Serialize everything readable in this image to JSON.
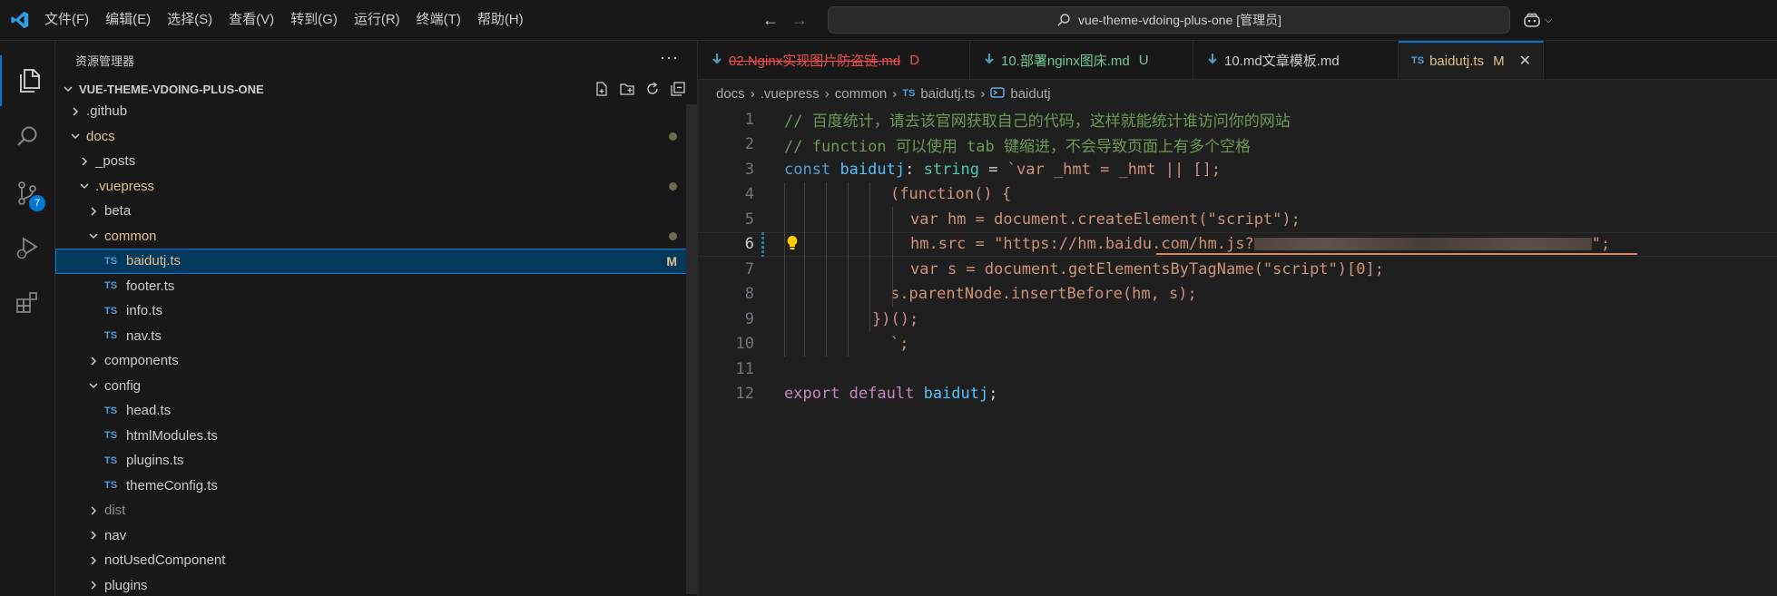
{
  "menu": [
    "文件(F)",
    "编辑(E)",
    "选择(S)",
    "查看(V)",
    "转到(G)",
    "运行(R)",
    "终端(T)",
    "帮助(H)"
  ],
  "search": {
    "text": "vue-theme-vdoing-plus-one [管理员]"
  },
  "activity": {
    "scm_badge": "7"
  },
  "sidebar": {
    "title": "资源管理器",
    "more": "···",
    "section": "VUE-THEME-VDOING-PLUS-ONE",
    "tree": [
      {
        "label": ".github",
        "type": "folder",
        "open": false,
        "level": 0
      },
      {
        "label": "docs",
        "type": "folder",
        "open": true,
        "level": 0,
        "dot": true,
        "modified": true
      },
      {
        "label": "_posts",
        "type": "folder",
        "open": false,
        "level": 1
      },
      {
        "label": ".vuepress",
        "type": "folder",
        "open": true,
        "level": 1,
        "dot": true,
        "modified": true
      },
      {
        "label": "beta",
        "type": "folder",
        "open": false,
        "level": 2
      },
      {
        "label": "common",
        "type": "folder",
        "open": true,
        "level": 2,
        "dot": true,
        "modified": true
      },
      {
        "label": "baidutj.ts",
        "type": "ts",
        "level": 3,
        "mark": "M",
        "selected": true,
        "modified": true
      },
      {
        "label": "footer.ts",
        "type": "ts",
        "level": 3
      },
      {
        "label": "info.ts",
        "type": "ts",
        "level": 3
      },
      {
        "label": "nav.ts",
        "type": "ts",
        "level": 3
      },
      {
        "label": "components",
        "type": "folder",
        "open": false,
        "level": 2
      },
      {
        "label": "config",
        "type": "folder",
        "open": true,
        "level": 2
      },
      {
        "label": "head.ts",
        "type": "ts",
        "level": 3
      },
      {
        "label": "htmlModules.ts",
        "type": "ts",
        "level": 3
      },
      {
        "label": "plugins.ts",
        "type": "ts",
        "level": 3
      },
      {
        "label": "themeConfig.ts",
        "type": "ts",
        "level": 3
      },
      {
        "label": "dist",
        "type": "folder",
        "open": false,
        "level": 2,
        "dim": true
      },
      {
        "label": "nav",
        "type": "folder",
        "open": false,
        "level": 2
      },
      {
        "label": "notUsedComponent",
        "type": "folder",
        "open": false,
        "level": 2
      },
      {
        "label": "plugins",
        "type": "folder",
        "open": false,
        "level": 2
      }
    ]
  },
  "tabs": [
    {
      "label": "02.Nginx实现图片防盗链.md",
      "status": "D",
      "color": "#f14c4c",
      "strike": true,
      "active": false
    },
    {
      "label": "10.部署nginx图床.md",
      "status": "U",
      "color": "#73c991",
      "strike": false,
      "active": false
    },
    {
      "label": "10.md文章模板.md",
      "status": "",
      "color": "#cccccc",
      "strike": false,
      "active": false
    },
    {
      "label": "baidutj.ts",
      "status": "M",
      "color": "#e2c08d",
      "strike": false,
      "active": true,
      "ts": true
    }
  ],
  "breadcrumb": [
    "docs",
    ".vuepress",
    "common",
    "baidutj.ts",
    "baidutj"
  ],
  "code": {
    "current_line": 6,
    "lines": [
      "1",
      "2",
      "3",
      "4",
      "5",
      "6",
      "7",
      "8",
      "9",
      "10",
      "11",
      "12"
    ],
    "l1": "// 百度统计，请去该官网获取自己的代码，这样就能统计谁访问你的网站",
    "l2": "// function 可以使用 tab 键缩进，不会导致页面上有多个空格",
    "l3_kw": "const",
    "l3_var": "baidutj",
    "l3_colon": ":",
    "l3_type": "string",
    "l3_eq": " = ",
    "l3_str": "`var _hmt = _hmt || [];",
    "l4": "(function() {",
    "l5": "var hm = document.createElement(\"script\");",
    "l6_a": "hm.src = \"https://hm.baidu.com/hm.js?",
    "l6_b": "\";",
    "l7": "var s = document.getElementsByTagName(\"script\")[0];",
    "l8": "s.parentNode.insertBefore(hm, s);",
    "l9": "})();",
    "l10": "`;",
    "l12_export": "export",
    "l12_default": "default",
    "l12_var": "baidutj",
    "l12_semi": ";"
  }
}
